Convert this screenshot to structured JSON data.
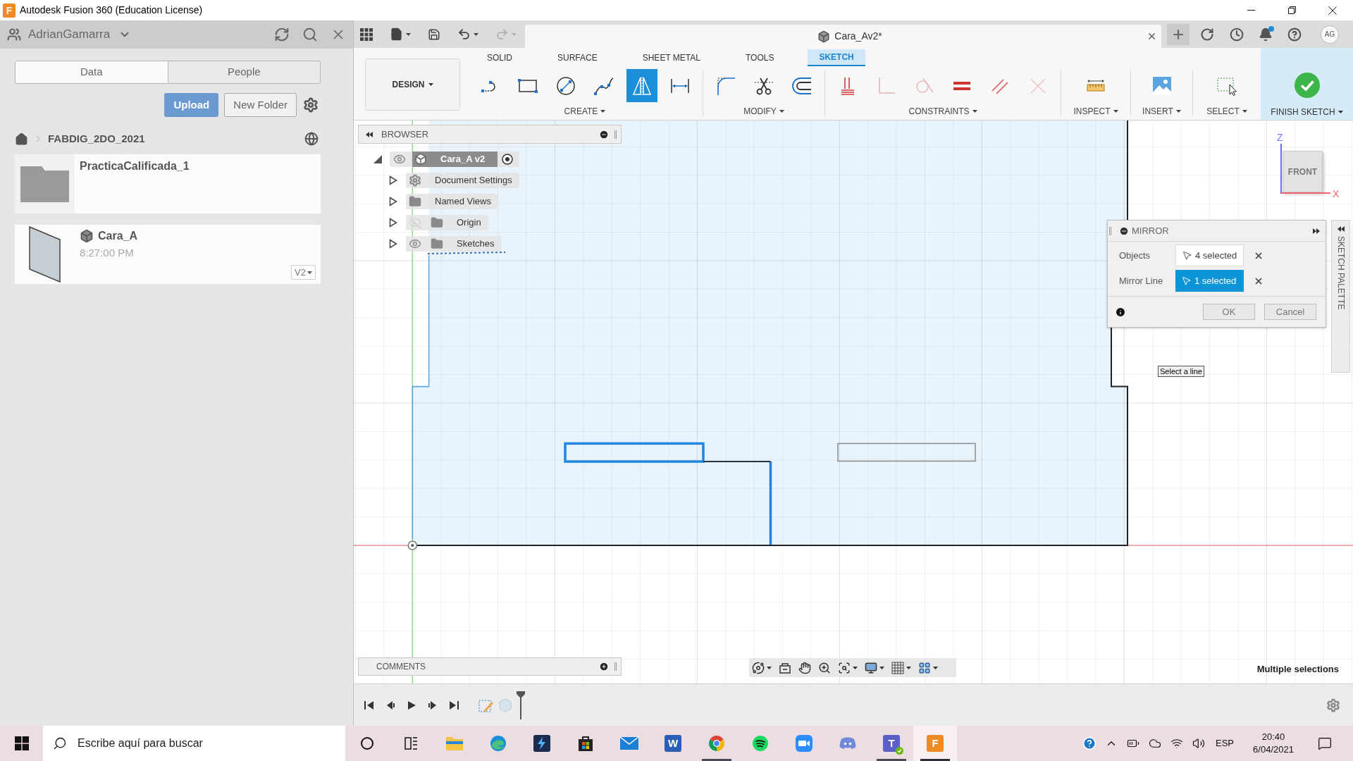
{
  "window": {
    "app_letter": "F",
    "title": "Autodesk Fusion 360 (Education License)"
  },
  "data_panel": {
    "user": "AdrianGamarra",
    "tabs": [
      {
        "label": "Data",
        "selected": true
      },
      {
        "label": "People",
        "selected": false
      }
    ],
    "actions": [
      {
        "kind": "primary",
        "label": "Upload"
      },
      {
        "kind": "secondary",
        "label": "New Folder"
      }
    ],
    "breadcrumb": "FABDIG_2DO_2021",
    "items": [
      {
        "kind": "folder",
        "name": "PracticaCalificada_1"
      },
      {
        "kind": "design",
        "name": "Cara_A",
        "time": "8:27:00 PM",
        "version": "V2"
      }
    ]
  },
  "tab_bar": {
    "quick_access": [
      {
        "kind": "apps",
        "disabled": false
      },
      {
        "kind": "file",
        "disabled": false
      },
      {
        "kind": "save",
        "disabled": false
      },
      {
        "kind": "undo",
        "disabled": false
      },
      {
        "kind": "redo",
        "disabled": true
      }
    ],
    "document": "Cara_Av2*",
    "user_initials": "AG"
  },
  "toolbar": {
    "workspace": "DESIGN",
    "tabs": [
      {
        "label": "SOLID",
        "selected": false
      },
      {
        "label": "SURFACE",
        "selected": false
      },
      {
        "label": "SHEET METAL",
        "selected": false
      },
      {
        "label": "TOOLS",
        "selected": false
      },
      {
        "label": "SKETCH",
        "selected": true
      }
    ],
    "groups": [
      {
        "label": "CREATE",
        "tools": [
          {
            "kind": "line",
            "selected": false
          },
          {
            "kind": "rectangle",
            "selected": false
          },
          {
            "kind": "circle",
            "selected": false
          },
          {
            "kind": "spline",
            "selected": false
          },
          {
            "kind": "mirror",
            "selected": true
          },
          {
            "kind": "dimension",
            "selected": false
          }
        ]
      },
      {
        "label": "MODIFY",
        "tools": [
          {
            "kind": "fillet",
            "selected": false
          },
          {
            "kind": "trim",
            "selected": false
          },
          {
            "kind": "offset",
            "selected": false
          }
        ]
      },
      {
        "label": "CONSTRAINTS",
        "tools": [
          {
            "kind": "hatch",
            "selected": false
          },
          {
            "kind": "corner",
            "selected": false
          },
          {
            "kind": "circle-line",
            "selected": false
          },
          {
            "kind": "equal",
            "selected": false
          },
          {
            "kind": "parallel",
            "selected": false
          },
          {
            "kind": "cross",
            "selected": false
          }
        ]
      },
      {
        "label": "INSPECT",
        "tools": [
          {
            "kind": "ruler",
            "selected": false
          }
        ]
      },
      {
        "label": "INSERT",
        "tools": [
          {
            "kind": "image",
            "selected": false
          }
        ]
      },
      {
        "label": "SELECT",
        "tools": [
          {
            "kind": "select-box",
            "selected": false
          }
        ]
      }
    ],
    "finish": "FINISH SKETCH"
  },
  "canvas": {
    "browser": {
      "title": "BROWSER",
      "root": {
        "label": "Cara_A v2",
        "expanded": true,
        "visible": true,
        "active": true,
        "children": [
          {
            "kind": "settings",
            "label": "Document Settings",
            "expanded": false
          },
          {
            "kind": "folder",
            "label": "Named Views",
            "expanded": false
          },
          {
            "kind": "folder",
            "label": "Origin",
            "expanded": false,
            "visible": false
          },
          {
            "kind": "folder",
            "label": "Sketches",
            "expanded": false,
            "visible": true
          }
        ]
      }
    },
    "sketch": {
      "entities": [
        {
          "kind": "rectangle",
          "selected": true
        },
        {
          "kind": "line",
          "selected": true
        },
        {
          "kind": "line",
          "selected": false
        },
        {
          "kind": "outline",
          "selected": false
        },
        {
          "kind": "preview",
          "selected": false
        },
        {
          "kind": "edge",
          "selected": false
        }
      ]
    },
    "view_cube": {
      "face": "FRONT",
      "up_axis": "Z",
      "right_axis": "X"
    },
    "mirror_dialog": {
      "title": "MIRROR",
      "fields": [
        {
          "label": "Objects",
          "value": "4 selected",
          "selected": false
        },
        {
          "label": "Mirror Line",
          "value": "1 selected",
          "selected": true
        }
      ],
      "buttons": [
        "OK",
        "Cancel"
      ]
    },
    "sketch_palette": "SKETCH PALETTE",
    "tooltip": "Select a line",
    "comments": "COMMENTS",
    "status": "Multiple selections"
  },
  "timeline": {
    "features": [
      {
        "kind": "sketch"
      },
      {
        "kind": "body"
      }
    ]
  },
  "taskbar": {
    "search_placeholder": "Escribe aquí para buscar",
    "apps": [
      {
        "kind": "ring",
        "selected": false,
        "running": false
      },
      {
        "kind": "task-view",
        "selected": false,
        "running": false
      },
      {
        "kind": "folder",
        "selected": false,
        "running": false
      },
      {
        "kind": "swirl",
        "selected": false,
        "running": false
      },
      {
        "kind": "lightning",
        "selected": false,
        "running": false
      },
      {
        "kind": "bag",
        "selected": false,
        "running": false
      },
      {
        "kind": "mail",
        "selected": false,
        "running": false
      },
      {
        "kind": "letter",
        "glyph": "W",
        "color": "#2b5fb8",
        "selected": false,
        "running": false
      },
      {
        "kind": "tricolor",
        "selected": false,
        "running": true
      },
      {
        "kind": "waves",
        "selected": false,
        "running": false
      },
      {
        "kind": "camera",
        "selected": false,
        "running": false
      },
      {
        "kind": "controller",
        "selected": false,
        "running": false
      },
      {
        "kind": "letter-badge",
        "glyph": "T",
        "color": "#5b5fc7",
        "selected": false,
        "running": true
      },
      {
        "kind": "letter",
        "glyph": "F",
        "color": "#f08a24",
        "selected": true,
        "running": true
      }
    ],
    "tray": {
      "language": "ESP",
      "time": "20:40",
      "date": "6/04/2021"
    }
  }
}
